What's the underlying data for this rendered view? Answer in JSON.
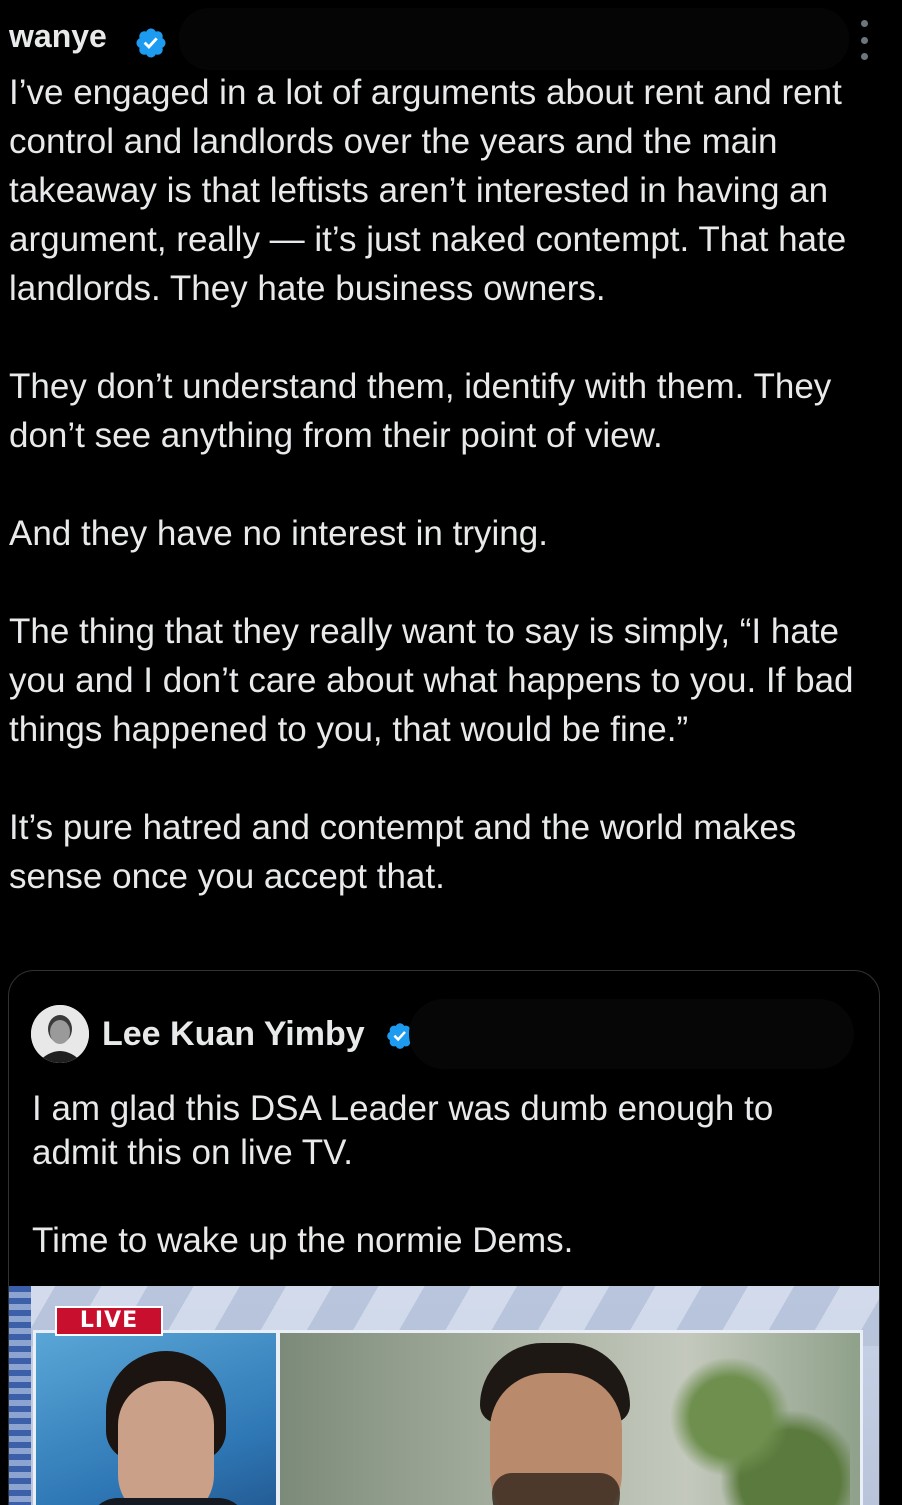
{
  "post": {
    "author_name": "wanye",
    "body": "I’ve engaged in a lot of arguments about rent and rent control and landlords over the years and the main takeaway is that leftists aren’t interested in having an argument, really — it’s just naked contempt. That hate landlords. They hate business owners.\n\nThey don’t understand them, identify with them. They don’t see anything from their point of view.\n\nAnd they have no interest in trying.\n\nThe thing that they really want to say is simply, “I hate you and I don’t care about what happens to you. If bad things happened to you, that would be fine.”\n\nIt’s pure hatred and contempt and the world makes sense once you accept that."
  },
  "quote": {
    "author_name": "Lee Kuan Yimby",
    "body": "I am glad this DSA Leader was dumb enough to admit this on live TV.\n\nTime to wake up the normie Dems.",
    "media": {
      "live_label": "LIVE"
    }
  },
  "colors": {
    "background": "#000000",
    "text": "#e7e9ea",
    "verified_blue": "#1d9bf0",
    "border": "#2f3336",
    "live_red": "#c8102e"
  },
  "icons": {
    "verified": "verified-badge-icon",
    "more": "more-options-icon"
  }
}
